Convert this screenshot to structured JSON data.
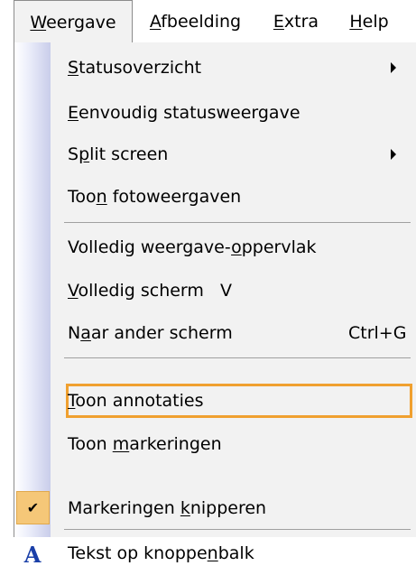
{
  "menubar": {
    "items": [
      {
        "label": "Weergave",
        "underline_index": 0
      },
      {
        "label": "Afbeelding",
        "underline_index": 0
      },
      {
        "label": "Extra",
        "underline_index": 0
      },
      {
        "label": "Help",
        "underline_index": 0
      }
    ]
  },
  "menu": {
    "items": [
      {
        "label": "Statusoverzicht",
        "mnemonic_index": 0,
        "submenu": true,
        "shortcut": ""
      },
      {
        "label": "Eenvoudig statusweergave",
        "mnemonic_index": 0,
        "submenu": false,
        "shortcut": ""
      },
      {
        "label": "Split screen",
        "mnemonic_index": 1,
        "submenu": true,
        "shortcut": ""
      },
      {
        "label": "Toon fotoweergaven",
        "mnemonic_index": 3,
        "submenu": false,
        "shortcut": ""
      },
      {
        "label": "Volledig weergave-oppervlak",
        "mnemonic_index": 18,
        "submenu": false,
        "shortcut": ""
      },
      {
        "label": "Volledig scherm   V",
        "mnemonic_index": 0,
        "submenu": false,
        "shortcut": ""
      },
      {
        "label": "Naar ander scherm",
        "mnemonic_index": 1,
        "submenu": false,
        "shortcut": "Ctrl+G"
      },
      {
        "label": "Toon annotaties",
        "mnemonic_index": 0,
        "submenu": false,
        "shortcut": "",
        "highlighted": true
      },
      {
        "label": "Toon markeringen",
        "mnemonic_index": 5,
        "submenu": false,
        "shortcut": ""
      },
      {
        "label": "Markeringen knipperen",
        "mnemonic_index": 12,
        "submenu": false,
        "shortcut": "",
        "checked": true
      },
      {
        "label": "Tekst op knoppenbalk",
        "mnemonic_index": 15,
        "submenu": false,
        "shortcut": "",
        "icon": "text-label-icon"
      }
    ]
  },
  "icons": {
    "checkmark": "✔",
    "text_icon": "A"
  },
  "colors": {
    "highlight_border": "#f0a030",
    "check_background": "#f5c778",
    "menu_background": "#f2f2f2",
    "text_icon_color": "#1a3fa8"
  }
}
